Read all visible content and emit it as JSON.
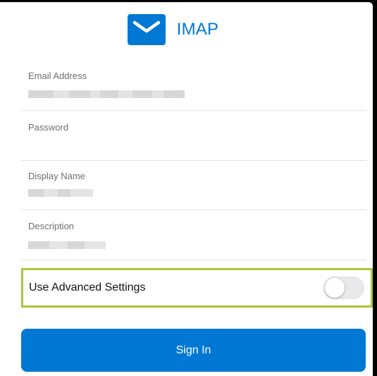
{
  "header": {
    "icon": "mail-envelope-icon",
    "title": "IMAP"
  },
  "form": {
    "email_label": "Email Address",
    "password_label": "Password",
    "display_name_label": "Display Name",
    "description_label": "Description"
  },
  "advanced": {
    "label": "Use Advanced Settings",
    "enabled": false
  },
  "signin": {
    "label": "Sign In"
  },
  "colors": {
    "accent": "#0078d4",
    "highlight": "#a8c83c",
    "background": "#ffffff"
  }
}
